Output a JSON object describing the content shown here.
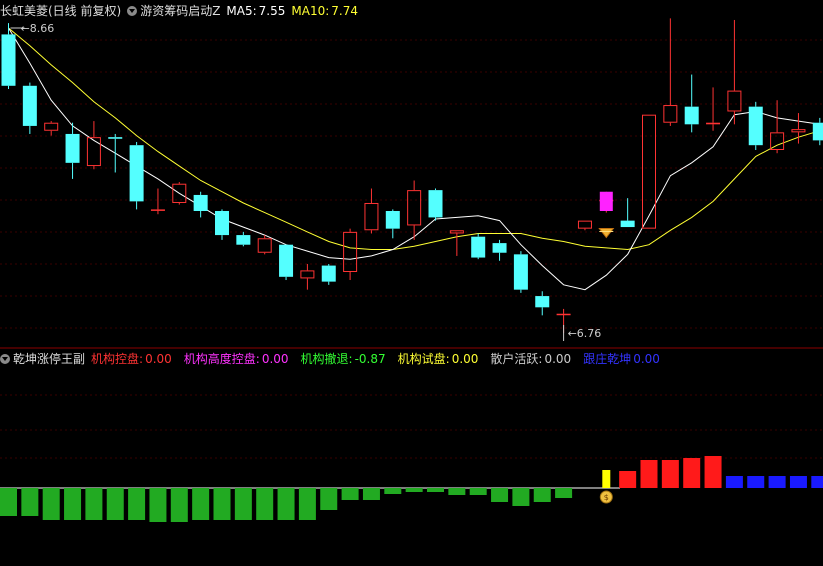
{
  "header": {
    "stock_title": "长虹美菱(日线 前复权)",
    "indicator1_name": "游资筹码启动Z",
    "ma5_label": "MA5:",
    "ma5_value": "7.55",
    "ma10_label": "MA10:",
    "ma10_value": "7.74",
    "ma5_color": "#ffffff",
    "ma10_color": "#ffff33"
  },
  "sub_header": {
    "indicator_name": "乾坤涨停王副",
    "items": [
      {
        "label": "机构控盘:",
        "value": "0.00",
        "color": "#ff3333"
      },
      {
        "label": "机构高度控盘:",
        "value": "0.00",
        "color": "#ff33ff"
      },
      {
        "label": "机构撤退:",
        "value": "-0.87",
        "color": "#33ff33"
      },
      {
        "label": "机构试盘:",
        "value": "0.00",
        "color": "#ffff33"
      },
      {
        "label": "散户活跃:",
        "value": "0.00",
        "color": "#cccccc"
      },
      {
        "label": "跟庄乾坤",
        "value": "0.00",
        "color": "#3333ff"
      }
    ]
  },
  "chart_data": [
    {
      "type": "candlestick",
      "annotations": {
        "high_label": "8.66",
        "low_label": "6.76"
      },
      "colors": {
        "up": "#ff3333",
        "down": "#54ffff",
        "ma5": "#ffffff",
        "ma10": "#ffff33"
      },
      "candles": [
        {
          "o": 8.62,
          "h": 8.69,
          "c": 8.3,
          "l": 8.28
        },
        {
          "o": 8.3,
          "h": 8.32,
          "c": 8.05,
          "l": 8.0
        },
        {
          "o": 8.02,
          "h": 8.08,
          "c": 8.07,
          "l": 7.99
        },
        {
          "o": 8.0,
          "h": 8.07,
          "c": 7.82,
          "l": 7.72
        },
        {
          "o": 7.8,
          "h": 8.08,
          "c": 7.98,
          "l": 7.78
        },
        {
          "o": 7.98,
          "h": 8.0,
          "c": 7.97,
          "l": 7.76
        },
        {
          "o": 7.93,
          "h": 7.95,
          "c": 7.58,
          "l": 7.53
        },
        {
          "o": 7.53,
          "h": 7.66,
          "c": 7.53,
          "l": 7.5
        },
        {
          "o": 7.57,
          "h": 7.7,
          "c": 7.69,
          "l": 7.56
        },
        {
          "o": 7.62,
          "h": 7.64,
          "c": 7.52,
          "l": 7.48
        },
        {
          "o": 7.52,
          "h": 7.53,
          "c": 7.37,
          "l": 7.34
        },
        {
          "o": 7.37,
          "h": 7.39,
          "c": 7.31,
          "l": 7.3
        },
        {
          "o": 7.26,
          "h": 7.37,
          "c": 7.35,
          "l": 7.25
        },
        {
          "o": 7.31,
          "h": 7.31,
          "c": 7.11,
          "l": 7.09
        },
        {
          "o": 7.1,
          "h": 7.19,
          "c": 7.15,
          "l": 7.03
        },
        {
          "o": 7.18,
          "h": 7.19,
          "c": 7.08,
          "l": 7.06
        },
        {
          "o": 7.14,
          "h": 7.41,
          "c": 7.39,
          "l": 7.09
        },
        {
          "o": 7.4,
          "h": 7.66,
          "c": 7.57,
          "l": 7.38
        },
        {
          "o": 7.52,
          "h": 7.53,
          "c": 7.41,
          "l": 7.35
        },
        {
          "o": 7.43,
          "h": 7.71,
          "c": 7.65,
          "l": 7.34
        },
        {
          "o": 7.65,
          "h": 7.66,
          "c": 7.48,
          "l": 7.46
        },
        {
          "o": 7.38,
          "h": 7.4,
          "c": 7.4,
          "l": 7.24
        },
        {
          "o": 7.36,
          "h": 7.38,
          "c": 7.23,
          "l": 7.22
        },
        {
          "o": 7.32,
          "h": 7.34,
          "c": 7.26,
          "l": 7.21
        },
        {
          "o": 7.25,
          "h": 7.27,
          "c": 7.03,
          "l": 7.01
        },
        {
          "o": 6.99,
          "h": 7.02,
          "c": 6.92,
          "l": 6.87
        },
        {
          "o": 6.88,
          "h": 6.91,
          "c": 6.88,
          "l": 6.76
        },
        {
          "o": 7.41,
          "h": 7.46,
          "c": 7.46,
          "l": 7.4
        },
        {
          "o": 7.59,
          "h": 7.64,
          "c": 7.59,
          "l": 7.51
        },
        {
          "o": 7.46,
          "h": 7.6,
          "c": 7.42,
          "l": 7.42
        },
        {
          "o": 7.41,
          "h": 8.12,
          "c": 8.12,
          "l": 7.41
        },
        {
          "o": 8.07,
          "h": 8.72,
          "c": 8.18,
          "l": 8.05
        },
        {
          "o": 8.17,
          "h": 8.37,
          "c": 8.06,
          "l": 8.01
        },
        {
          "o": 8.06,
          "h": 8.29,
          "c": 8.07,
          "l": 8.02
        },
        {
          "o": 8.14,
          "h": 8.71,
          "c": 8.27,
          "l": 8.06
        },
        {
          "o": 8.17,
          "h": 8.2,
          "c": 7.93,
          "l": 7.9
        },
        {
          "o": 7.9,
          "h": 8.21,
          "c": 8.01,
          "l": 7.88
        },
        {
          "o": 8.01,
          "h": 8.13,
          "c": 8.03,
          "l": 7.94
        },
        {
          "o": 8.07,
          "h": 8.1,
          "c": 7.96,
          "l": 7.93
        }
      ],
      "ma5": [
        8.66,
        8.44,
        8.21,
        8.05,
        7.96,
        7.88,
        7.8,
        7.72,
        7.63,
        7.55,
        7.47,
        7.42,
        7.37,
        7.31,
        7.27,
        7.23,
        7.22,
        7.24,
        7.28,
        7.36,
        7.47,
        7.48,
        7.49,
        7.46,
        7.31,
        7.18,
        7.06,
        7.03,
        7.12,
        7.25,
        7.49,
        7.74,
        7.82,
        7.92,
        8.12,
        8.14,
        8.1,
        8.08,
        8.06
      ],
      "ma10": [
        8.66,
        8.55,
        8.43,
        8.32,
        8.2,
        8.1,
        7.99,
        7.89,
        7.8,
        7.71,
        7.64,
        7.57,
        7.51,
        7.45,
        7.39,
        7.33,
        7.29,
        7.28,
        7.28,
        7.3,
        7.33,
        7.36,
        7.38,
        7.38,
        7.38,
        7.35,
        7.33,
        7.3,
        7.29,
        7.28,
        7.31,
        7.4,
        7.48,
        7.58,
        7.72,
        7.86,
        7.93,
        7.98,
        8.02
      ]
    },
    {
      "type": "bar",
      "series": [
        {
          "name": "机构撤退",
          "color": "#22aa22",
          "values": [
            -0.28,
            -0.28,
            -0.32,
            -0.32,
            -0.32,
            -0.32,
            -0.32,
            -0.34,
            -0.34,
            -0.32,
            -0.32,
            -0.32,
            -0.32,
            -0.32,
            -0.32,
            -0.22,
            -0.12,
            -0.12,
            -0.06,
            -0.04,
            -0.04,
            -0.07,
            -0.07,
            -0.14,
            -0.18,
            -0.14,
            -0.1,
            0,
            0,
            0,
            0,
            0,
            0,
            0,
            0,
            0,
            0,
            0,
            0
          ]
        },
        {
          "name": "机构试盘",
          "color": "#ffff00",
          "values": [
            0,
            0,
            0,
            0,
            0,
            0,
            0,
            0,
            0,
            0,
            0,
            0,
            0,
            0,
            0,
            0,
            0,
            0,
            0,
            0,
            0,
            0,
            0,
            0,
            0,
            0,
            0,
            0,
            0.18,
            0,
            0,
            0,
            0,
            0,
            0,
            0,
            0,
            0,
            0
          ]
        },
        {
          "name": "机构控盘",
          "color": "#ff1a1a",
          "values": [
            0,
            0,
            0,
            0,
            0,
            0,
            0,
            0,
            0,
            0,
            0,
            0,
            0,
            0,
            0,
            0,
            0,
            0,
            0,
            0,
            0,
            0,
            0,
            0,
            0,
            0,
            0,
            0,
            0,
            0.17,
            0.28,
            0.28,
            0.3,
            0.32,
            0,
            0,
            0,
            0,
            0
          ]
        },
        {
          "name": "跟庄乾坤",
          "color": "#1a1aff",
          "values": [
            0,
            0,
            0,
            0,
            0,
            0,
            0,
            0,
            0,
            0,
            0,
            0,
            0,
            0,
            0,
            0,
            0,
            0,
            0,
            0,
            0,
            0,
            0,
            0,
            0,
            0,
            0,
            0,
            0,
            0,
            0,
            0,
            0,
            0,
            0.12,
            0.12,
            0.12,
            0.12,
            0.12
          ]
        }
      ]
    }
  ]
}
